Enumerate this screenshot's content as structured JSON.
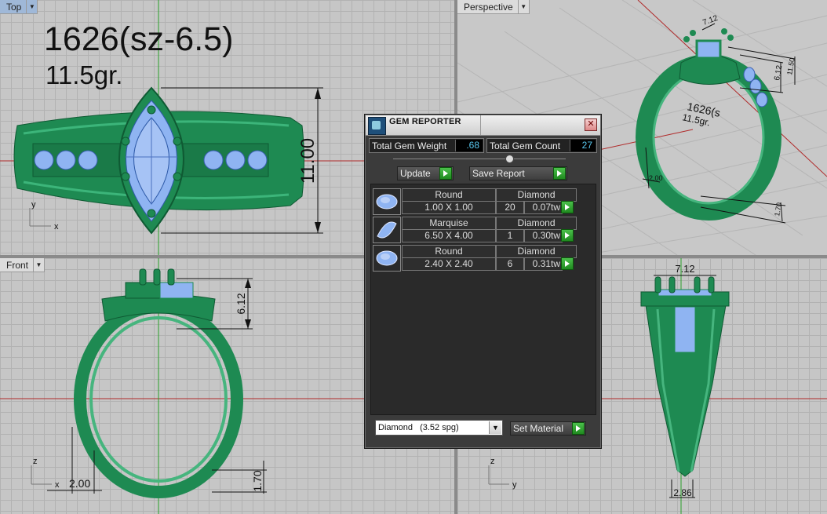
{
  "viewports": {
    "top": {
      "label": "Top",
      "title": "1626(sz-6.5)",
      "weight": "11.5gr.",
      "dim_height": "11.00",
      "axis_y": "y",
      "axis_x": "x"
    },
    "perspective": {
      "label": "Perspective",
      "dim_a": "7.12",
      "dim_b": "6.12",
      "dim_c": "11.50",
      "dim_d": "2.00",
      "dim_e": "1.70",
      "engraving": "1626(s",
      "engraving2": "11.5gr."
    },
    "front": {
      "label": "Front",
      "dim_height": "6.12",
      "dim_width": "2.00",
      "dim_thick": "1.70",
      "axis_z": "z",
      "axis_x": "x"
    },
    "right": {
      "dim_top": "7.12",
      "dim_bottom": "2.86",
      "axis_z": "z",
      "axis_y": "y"
    }
  },
  "gem_reporter": {
    "title": "GEM REPORTER",
    "close_glyph": "✕",
    "total_weight_label": "Total Gem Weight",
    "total_weight_value": ".68",
    "total_count_label": "Total Gem Count",
    "total_count_value": "27",
    "update_label": "Update",
    "save_report_label": "Save Report",
    "gems": [
      {
        "shape": "Round",
        "material": "Diamond",
        "size": "1.00 X 1.00",
        "count": "20",
        "weight": "0.07tw"
      },
      {
        "shape": "Marquise",
        "material": "Diamond",
        "size": "6.50 X 4.00",
        "count": "1",
        "weight": "0.30tw"
      },
      {
        "shape": "Round",
        "material": "Diamond",
        "size": "2.40 X 2.40",
        "count": "6",
        "weight": "0.31tw"
      }
    ],
    "material_select": {
      "value": "Diamond",
      "spg": "(3.52 spg)"
    },
    "set_material_label": "Set Material"
  },
  "colors": {
    "ring_green": "#1f8a55",
    "gem_blue": "#8fb4f2",
    "axis_red": "#b02a2a",
    "axis_green": "#2aa02a"
  }
}
